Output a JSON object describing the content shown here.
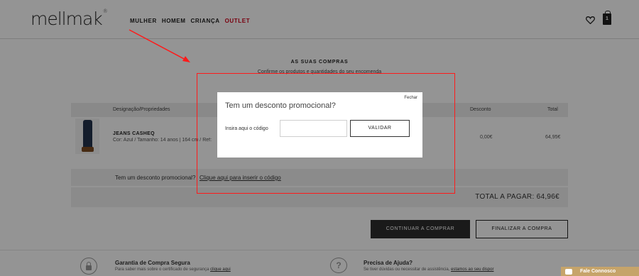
{
  "header": {
    "logo": "mellmak",
    "logo_mark": "®",
    "nav": [
      "MULHER",
      "HOMEM",
      "CRIANÇA",
      "OUTLET"
    ],
    "bag_count": "1"
  },
  "cart": {
    "title": "AS SUAS COMPRAS",
    "subtitle": "Confirme os produtos e quantidades do seu encomenda",
    "columns": {
      "designation": "Designação/Propriedades",
      "discount": "Desconto",
      "total": "Total"
    },
    "item": {
      "name": "JEANS CASHEQ",
      "properties": "Cor: Azul / Tamanho: 14 anos | 164 cm / Ref:",
      "discount": "0,00€",
      "total": "64,95€"
    },
    "promo_question": "Tem um desconto promocional?",
    "promo_link": "Clique aqui para inserir o código",
    "total_to_pay": "TOTAL A PAGAR: 64,96€",
    "continue_button": "CONTINUAR A COMPRAR",
    "finish_button": "FINALIZAR A COMPRA"
  },
  "features": {
    "secure": {
      "title": "Garantia de Compra Segura",
      "text": "Para saber mais sobre o certificado de segurança",
      "link": "clique aqui"
    },
    "help": {
      "title": "Precisa de Ajuda?",
      "text": "Se tiver dúvidas ou necessitar de assistência,",
      "link": "estamos ao seu dispor"
    }
  },
  "chat": {
    "label": "Fale Connosco"
  },
  "modal": {
    "close_label": "Fechar",
    "title": "Tem um desconto promocional?",
    "code_label": "Insira aqui o código",
    "code_value": "",
    "code_placeholder": "",
    "validate_button": "VALIDAR"
  },
  "colors": {
    "outlet": "#d0021b",
    "annotation": "#ff1a1a",
    "chat": "#c6a46a",
    "overlay": "rgba(0,0,0,0.42)"
  }
}
